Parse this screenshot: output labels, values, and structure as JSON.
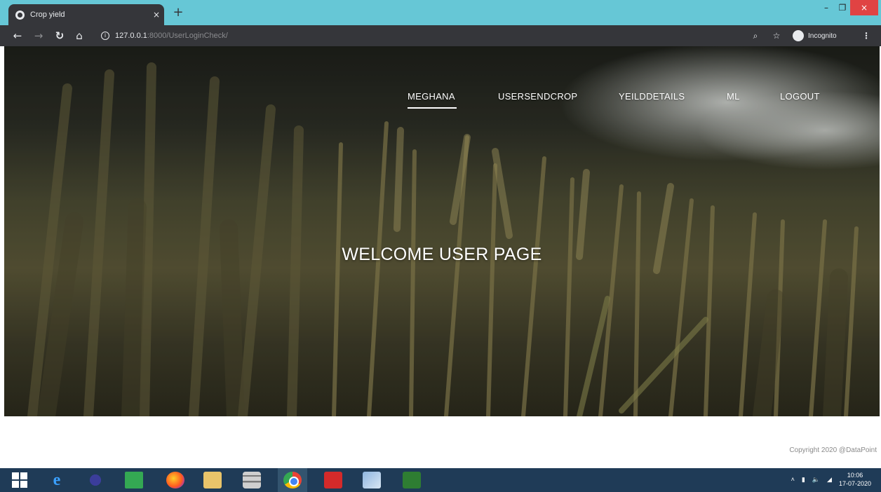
{
  "browser": {
    "tab_title": "Crop yield",
    "tab_close": "×",
    "new_tab": "+",
    "url_host": "127.0.0.1",
    "url_path": ":8000/UserLoginCheck/",
    "profile_label": "Incognito",
    "window_controls": {
      "minimize": "–",
      "maximize": "❐",
      "close": "×"
    }
  },
  "nav": {
    "items": [
      {
        "label": "MEGHANA",
        "active": true
      },
      {
        "label": "USERSENDCROP"
      },
      {
        "label": "YEILDDETAILS"
      },
      {
        "label": "ML"
      },
      {
        "label": "LOGOUT"
      }
    ]
  },
  "hero": {
    "title": "WELCOME USER PAGE"
  },
  "footer": {
    "copyright": "Copyright 2020 @DataPoint"
  },
  "taskbar": {
    "ie_glyph": "e",
    "clock_time": "10:06",
    "clock_date": "17-07-2020"
  },
  "colors": {
    "tabstrip": "#66c7d6",
    "toolbar": "#35363a",
    "taskbar": "#1f3b57"
  }
}
